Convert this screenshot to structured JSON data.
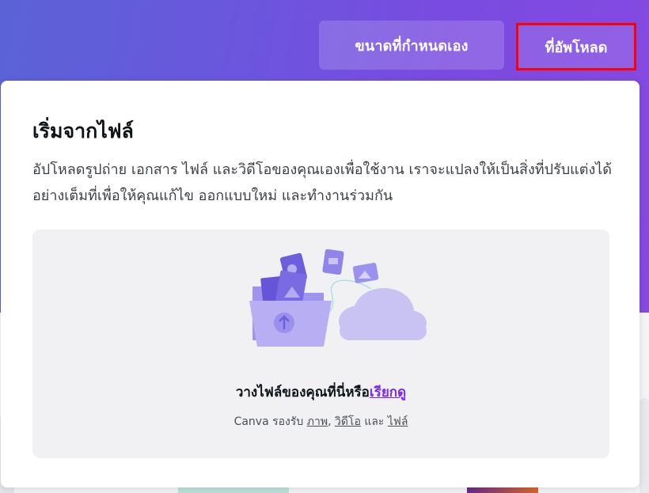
{
  "header": {
    "custom_size_label": "ขนาดที่กำหนดเอง",
    "upload_label": "ที่อัพโหลด",
    "gradient_start": "#5a63d6",
    "gradient_end": "#8649e2",
    "highlight_border": "#ff0000"
  },
  "panel": {
    "title": "เริ่มจากไฟล์",
    "description": "อัปโหลดรูปถ่าย เอกสาร ไฟล์ และวิดีโอของคุณเองเพื่อใช้งาน เราจะแปลงให้เป็นสิ่งที่ปรับแต่งได้อย่างเต็มที่เพื่อให้คุณแก้ไข ออกแบบใหม่ และทำงานร่วมกัน",
    "dropzone": {
      "illustration": "upload-folder-cloud-illustration",
      "drop_text": "วางไฟล์ของคุณที่นี่หรือ",
      "browse_link": "เรียกดู",
      "supports_prefix": "Canva รองรับ",
      "photos_link": "ภาพ",
      "separator": ",",
      "videos_link": "วิดีโอ",
      "and_text": "และ",
      "files_link": "ไฟล์"
    },
    "accent_color": "#7d2ae8"
  }
}
